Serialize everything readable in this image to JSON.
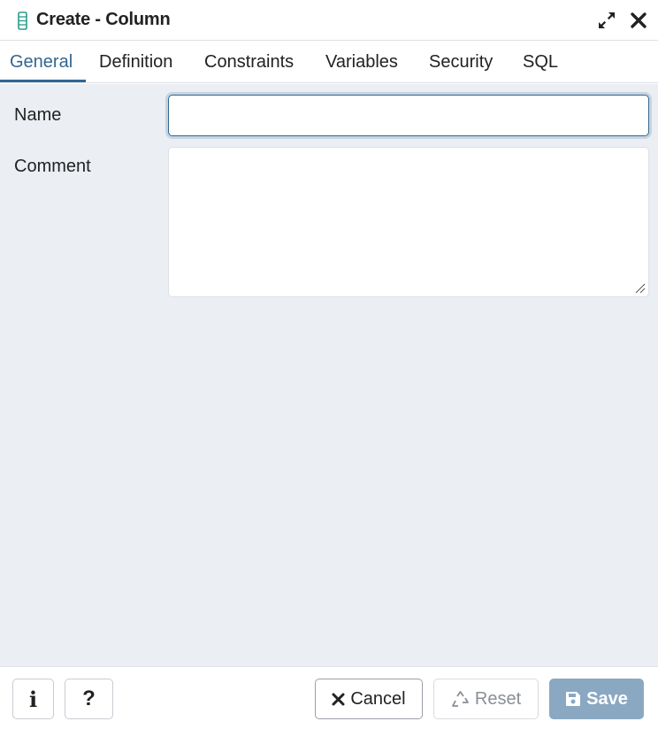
{
  "dialog": {
    "title": "Create - Column",
    "icons": {
      "title": "column-icon",
      "maximize": "maximize-icon",
      "close": "close-icon"
    }
  },
  "tabs": [
    {
      "label": "General",
      "active": true
    },
    {
      "label": "Definition",
      "active": false
    },
    {
      "label": "Constraints",
      "active": false
    },
    {
      "label": "Variables",
      "active": false
    },
    {
      "label": "Security",
      "active": false
    },
    {
      "label": "SQL",
      "active": false
    }
  ],
  "form": {
    "name_label": "Name",
    "name_value": "",
    "comment_label": "Comment",
    "comment_value": ""
  },
  "footer": {
    "info_glyph": "i",
    "help_glyph": "?",
    "cancel_label": "Cancel",
    "reset_label": "Reset",
    "save_label": "Save"
  },
  "colors": {
    "accent": "#326690",
    "body_bg": "#ebeef3",
    "save_bg": "#8aa8c2",
    "column_icon": "#2b9c8a"
  }
}
